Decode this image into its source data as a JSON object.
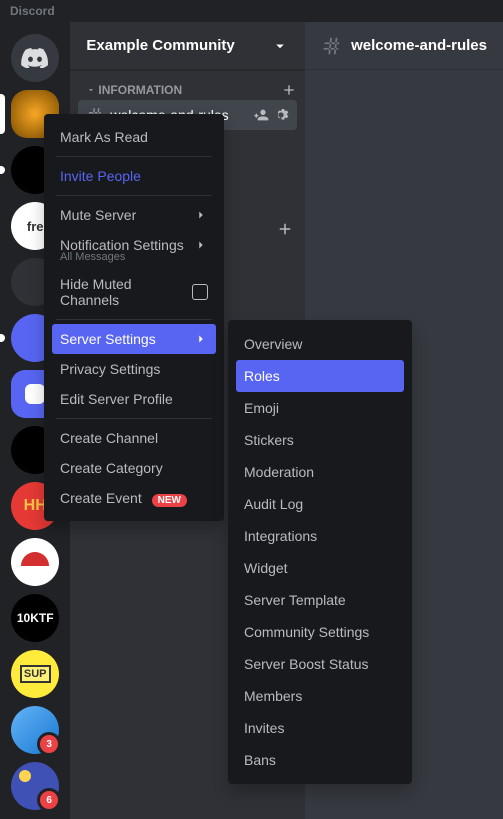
{
  "app": {
    "name": "Discord"
  },
  "servers": [
    {
      "id": "home",
      "label": "",
      "badge": null
    },
    {
      "id": "orange",
      "label": "",
      "badge": null,
      "pill": true
    },
    {
      "id": "black1",
      "label": "",
      "badge": null,
      "pill": true
    },
    {
      "id": "fre",
      "label": "fre",
      "badge": null
    },
    {
      "id": "gray1",
      "label": "",
      "badge": null
    },
    {
      "id": "purple1",
      "label": "",
      "badge": null,
      "pill": true
    },
    {
      "id": "homebtn",
      "label": "",
      "badge": null
    },
    {
      "id": "face",
      "label": "",
      "badge": null
    },
    {
      "id": "hh",
      "label": "HH",
      "badge": null
    },
    {
      "id": "cap",
      "label": "",
      "badge": null
    },
    {
      "id": "ktf",
      "label": "10KTF",
      "badge": null
    },
    {
      "id": "sup",
      "label": "SUP",
      "badge": null
    },
    {
      "id": "badge3",
      "label": "",
      "badge": "3"
    },
    {
      "id": "badge6",
      "label": "",
      "badge": "6"
    }
  ],
  "sidebar": {
    "server_name": "Example Community",
    "category": "INFORMATION",
    "channel": "welcome-and-rules"
  },
  "content": {
    "channel_title": "welcome-and-rules"
  },
  "context_menu": {
    "mark_read": "Mark As Read",
    "invite": "Invite People",
    "mute": "Mute Server",
    "notif": "Notification Settings",
    "notif_sub": "All Messages",
    "hide_muted": "Hide Muted Channels",
    "server_settings": "Server Settings",
    "privacy": "Privacy Settings",
    "edit_profile": "Edit Server Profile",
    "create_channel": "Create Channel",
    "create_category": "Create Category",
    "create_event": "Create Event",
    "new_badge": "NEW"
  },
  "submenu": {
    "items": [
      "Overview",
      "Roles",
      "Emoji",
      "Stickers",
      "Moderation",
      "Audit Log",
      "Integrations",
      "Widget",
      "Server Template",
      "Community Settings",
      "Server Boost Status",
      "Members",
      "Invites",
      "Bans"
    ],
    "active_index": 1
  }
}
